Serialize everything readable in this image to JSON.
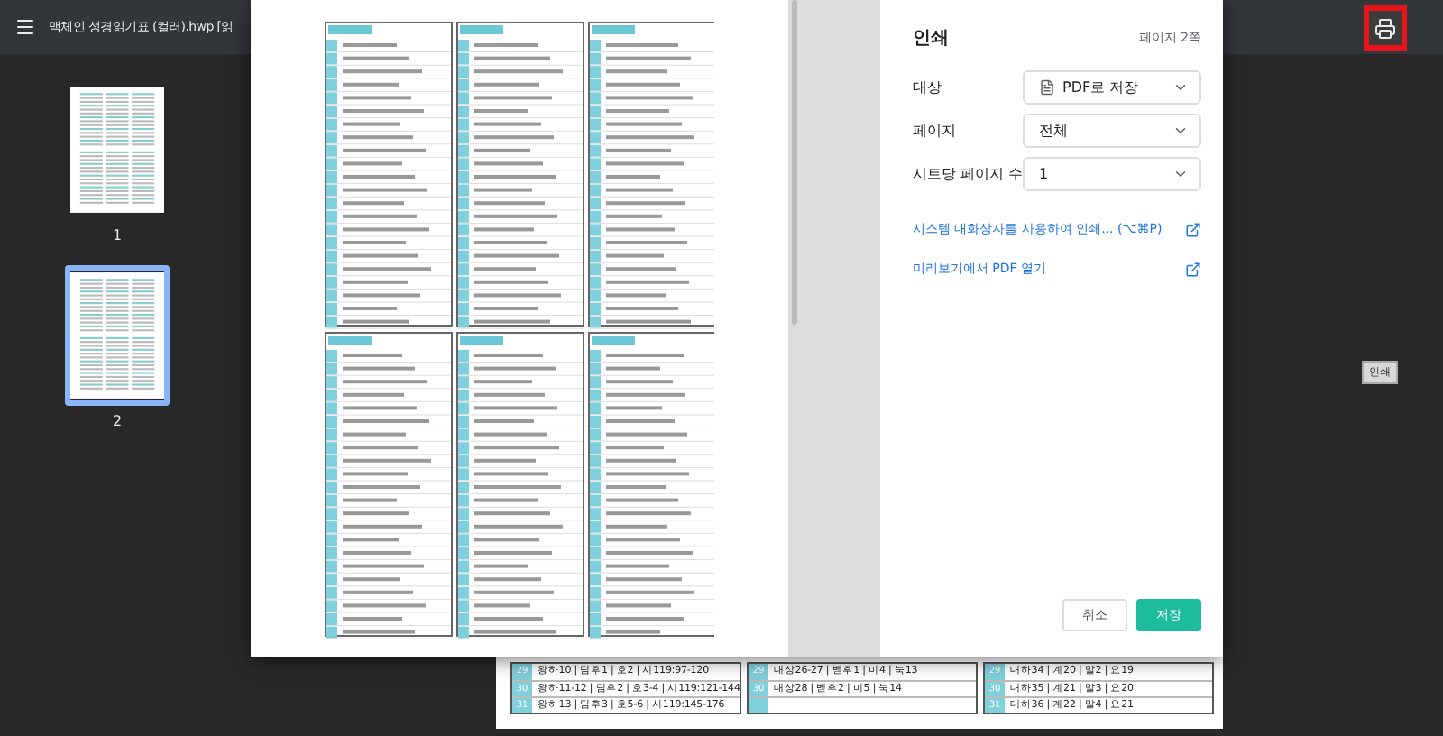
{
  "viewer": {
    "title": "맥체인 성경읽기표 (컬러).hwp [읽",
    "thumbnails": [
      {
        "label": "1",
        "selected": false
      },
      {
        "label": "2",
        "selected": true
      }
    ],
    "print_button": {
      "highlighted": true
    },
    "tooltip": "인쇄",
    "background_tables": [
      {
        "rows": [
          {
            "number": "29",
            "text": "왕하10 | 딤후1 | 호2 | 시119:97-120"
          },
          {
            "number": "30",
            "text": "왕하11-12 | 딤후2 | 호3-4 | 시119:121-144"
          },
          {
            "number": "31",
            "text": "왕하13 | 딤후3 | 호5-6 | 시119:145-176"
          }
        ]
      },
      {
        "rows": [
          {
            "number": "29",
            "text": "대상26-27 | 벧후1 | 미4 | 눅13"
          },
          {
            "number": "30",
            "text": "대상28 | 벧후2 | 미5 | 눅14"
          },
          {}
        ]
      },
      {
        "rows": [
          {
            "number": "29",
            "text": "대하34 | 계20 | 말2 | 요19"
          },
          {
            "number": "30",
            "text": "대하35 | 계21 | 말3 | 요20"
          },
          {
            "number": "31",
            "text": "대하36 | 계22 | 말4 | 요21"
          }
        ]
      }
    ]
  },
  "print_dialog": {
    "title": "인쇄",
    "page_count": "페이지 2쪽",
    "settings": [
      {
        "label": "대상",
        "value": "PDF로 저장",
        "kind": "destination"
      },
      {
        "label": "페이지",
        "value": "전체",
        "kind": "select"
      },
      {
        "label": "시트당 페이지 수",
        "value": "1",
        "kind": "select"
      }
    ],
    "links": [
      "시스템 대화상자를 사용하여 인쇄... (⌥⌘P)",
      "미리보기에서 PDF 열기"
    ],
    "buttons": [
      {
        "label": "취소",
        "kind": "secondary"
      },
      {
        "label": "저장",
        "kind": "primary"
      }
    ]
  }
}
